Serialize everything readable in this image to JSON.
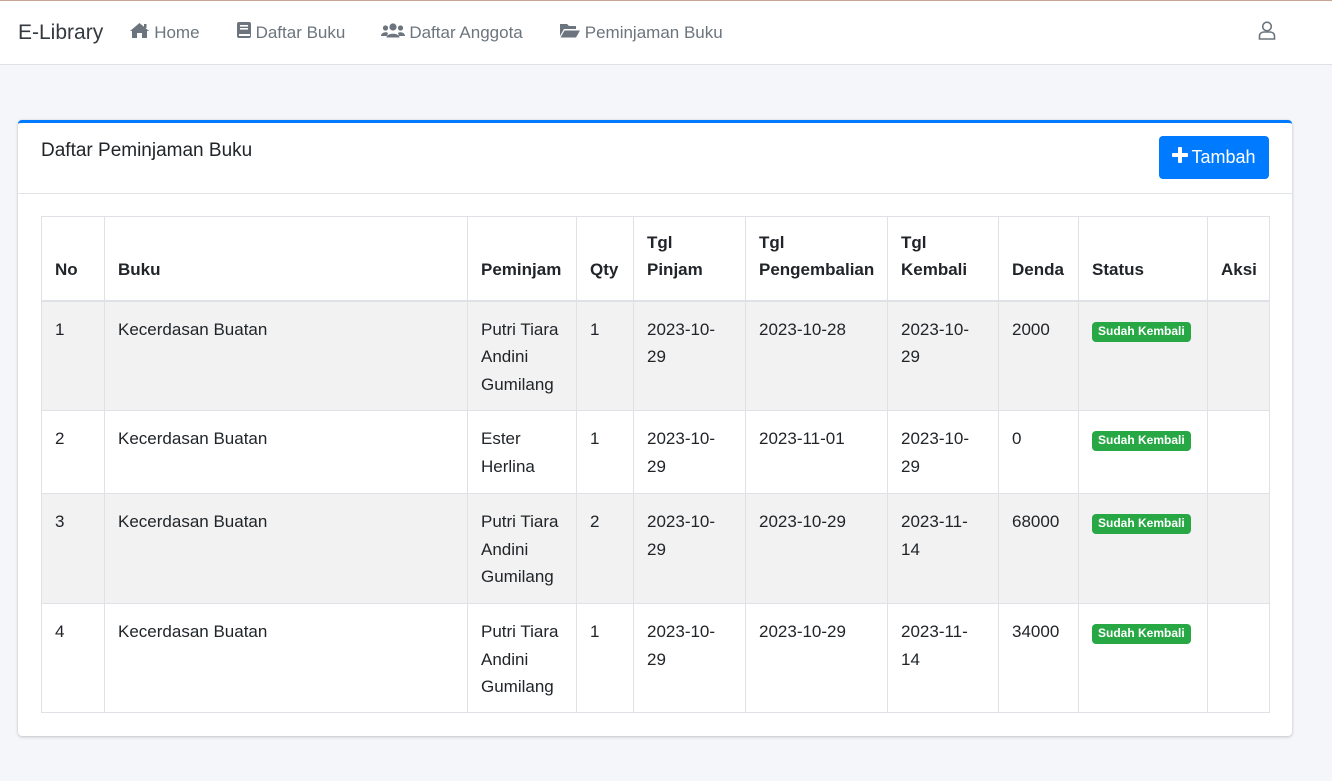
{
  "navbar": {
    "brand": "E-Library",
    "items": [
      {
        "label": "Home",
        "icon": "home-icon"
      },
      {
        "label": "Daftar Buku",
        "icon": "book-icon"
      },
      {
        "label": "Daftar Anggota",
        "icon": "users-icon"
      },
      {
        "label": "Peminjaman Buku",
        "icon": "folder-open-icon"
      }
    ],
    "user_icon": "user-icon"
  },
  "card": {
    "title": "Daftar Peminjaman Buku",
    "add_button_label": "Tambah",
    "accent_color": "#007bff"
  },
  "table": {
    "headers": {
      "no": "No",
      "buku": "Buku",
      "peminjam": "Peminjam",
      "qty": "Qty",
      "tgl_pinjam_1": "Tgl",
      "tgl_pinjam_2": "Pinjam",
      "tgl_pengembalian_1": "Tgl",
      "tgl_pengembalian_2": "Pengembalian",
      "tgl_kembali_1": "Tgl",
      "tgl_kembali_2": "Kembali",
      "denda": "Denda",
      "status": "Status",
      "aksi": "Aksi"
    },
    "rows": [
      {
        "no": "1",
        "buku": "Kecerdasan Buatan",
        "peminjam": [
          "Putri Tiara",
          "Andini",
          "Gumilang"
        ],
        "qty": "1",
        "tgl_pinjam": "2023-10-29",
        "tgl_pengembalian": "2023-10-28",
        "tgl_kembali": "2023-10-29",
        "denda": "2000",
        "status": "Sudah Kembali"
      },
      {
        "no": "2",
        "buku": "Kecerdasan Buatan",
        "peminjam": [
          "Ester",
          "Herlina"
        ],
        "qty": "1",
        "tgl_pinjam": "2023-10-29",
        "tgl_pengembalian": "2023-11-01",
        "tgl_kembali": "2023-10-29",
        "denda": "0",
        "status": "Sudah Kembali"
      },
      {
        "no": "3",
        "buku": "Kecerdasan Buatan",
        "peminjam": [
          "Putri Tiara",
          "Andini",
          "Gumilang"
        ],
        "qty": "2",
        "tgl_pinjam": "2023-10-29",
        "tgl_pengembalian": "2023-10-29",
        "tgl_kembali": "2023-11-14",
        "denda": "68000",
        "status": "Sudah Kembali"
      },
      {
        "no": "4",
        "buku": "Kecerdasan Buatan",
        "peminjam": [
          "Putri Tiara",
          "Andini",
          "Gumilang"
        ],
        "qty": "1",
        "tgl_pinjam": "2023-10-29",
        "tgl_pengembalian": "2023-10-29",
        "tgl_kembali": "2023-11-14",
        "denda": "34000",
        "status": "Sudah Kembali"
      }
    ],
    "status_color": "#28a745"
  }
}
